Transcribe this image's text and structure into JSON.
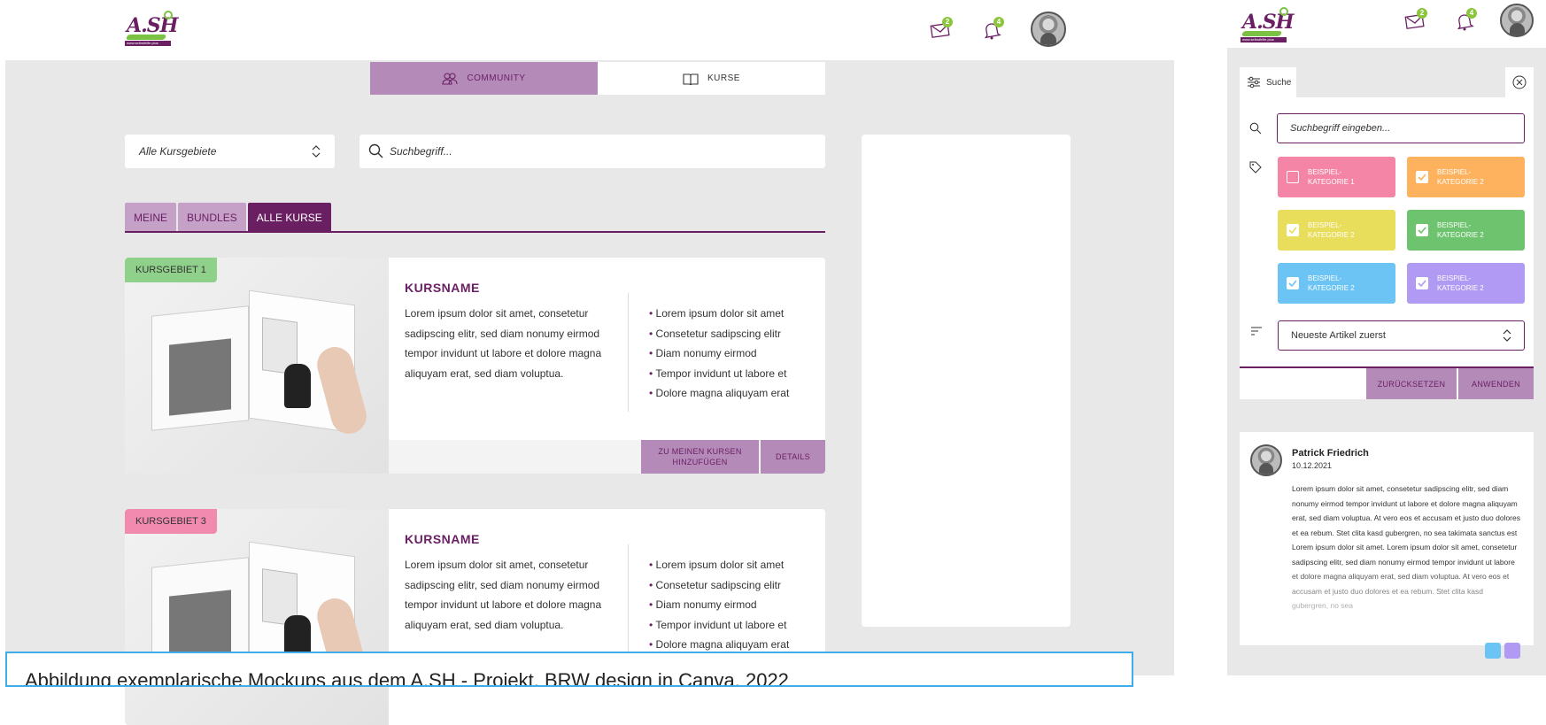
{
  "brand": {
    "logo_text": "A.SH",
    "logo_url_text": "www.selbsthilfe.plus"
  },
  "colors": {
    "purple_dark": "#6a1f63",
    "purple_light": "#b48ab9",
    "green": "#8cc63f",
    "pink": "#f07ca3",
    "gray_bg": "#e8e8e8"
  },
  "header": {
    "mail_badge": "2",
    "bell_badge": "4",
    "mail_icon": "envelope-icon",
    "bell_icon": "bell-icon"
  },
  "nav_tabs": [
    {
      "label": "COMMUNITY",
      "icon": "users-icon",
      "active": true
    },
    {
      "label": "KURSE",
      "icon": "book-icon",
      "active": false
    }
  ],
  "filters": {
    "area_select": "Alle Kursgebiete",
    "search_placeholder": "Suchbegriff..."
  },
  "course_tabs": [
    {
      "label": "MEINE",
      "active": false
    },
    {
      "label": "BUNDLES",
      "active": false
    },
    {
      "label": "ALLE KURSE",
      "active": true
    }
  ],
  "courses": [
    {
      "badge": "KURSGEBIET 1",
      "badge_color": "#8fd18a",
      "title": "KURSNAME",
      "description": "Lorem ipsum dolor sit amet, consetetur sadipscing elitr, sed diam nonumy eirmod tempor invidunt ut labore et dolore magna aliquyam erat, sed diam voluptua.",
      "bullets": [
        "Lorem ipsum dolor sit amet",
        "Consetetur sadipscing elitr",
        "Diam nonumy eirmod",
        "Tempor invidunt ut labore et",
        "Dolore magna aliquyam erat"
      ],
      "btn_add": "ZU MEINEN KURSEN HINZUFÜGEN",
      "btn_details": "DETAILS"
    },
    {
      "badge": "KURSGEBIET 3",
      "badge_color": "#f28ab0",
      "title": "KURSNAME",
      "description": "Lorem ipsum dolor sit amet, consetetur sadipscing elitr, sed diam nonumy eirmod tempor invidunt ut labore et dolore magna aliquyam erat, sed diam voluptua.",
      "bullets": [
        "Lorem ipsum dolor sit amet",
        "Consetetur sadipscing elitr",
        "Diam nonumy eirmod",
        "Tempor invidunt ut labore et",
        "Dolore magna aliquyam erat"
      ]
    }
  ],
  "caption": "Abbildung exemplarische Mockups aus dem A.SH - Projekt, BRW design in Canva, 2022",
  "filter_panel": {
    "tab_label": "Suche",
    "search_placeholder": "Suchbegriff eingeben...",
    "chips": [
      {
        "label": "BEISPIEL-KATEGORIE 1",
        "color": "#f585a6",
        "checked": false
      },
      {
        "label": "BEISPIEL-KATEGORIE 2",
        "color": "#ffb25e",
        "checked": true
      },
      {
        "label": "BEISPIEL-KATEGORIE 2",
        "color": "#e9dd5c",
        "checked": true
      },
      {
        "label": "BEISPIEL-KATEGORIE 2",
        "color": "#6ec46e",
        "checked": true
      },
      {
        "label": "BEISPIEL-KATEGORIE 2",
        "color": "#6cc4f5",
        "checked": true
      },
      {
        "label": "BEISPIEL-KATEGORIE 2",
        "color": "#b09af3",
        "checked": true
      }
    ],
    "sort_value": "Neueste Artikel zuerst",
    "btn_reset": "ZURÜCKSETZEN",
    "btn_apply": "ANWENDEN"
  },
  "post": {
    "author": "Patrick Friedrich",
    "date": "10.12.2021",
    "text": "Lorem ipsum dolor sit amet, consetetur sadipscing elitr, sed diam nonumy eirmod tempor invidunt ut labore et dolore magna aliquyam erat, sed diam voluptua. At vero eos et accusam et justo duo dolores et ea rebum. Stet clita kasd gubergren, no sea takimata sanctus est Lorem ipsum dolor sit amet. Lorem ipsum dolor sit amet, consetetur sadipscing elitr, sed diam nonumy eirmod tempor invidunt ut labore et dolore magna aliquyam erat, sed diam voluptua. At vero eos et accusam et justo duo dolores et ea rebum. Stet clita kasd gubergren, no sea"
  }
}
